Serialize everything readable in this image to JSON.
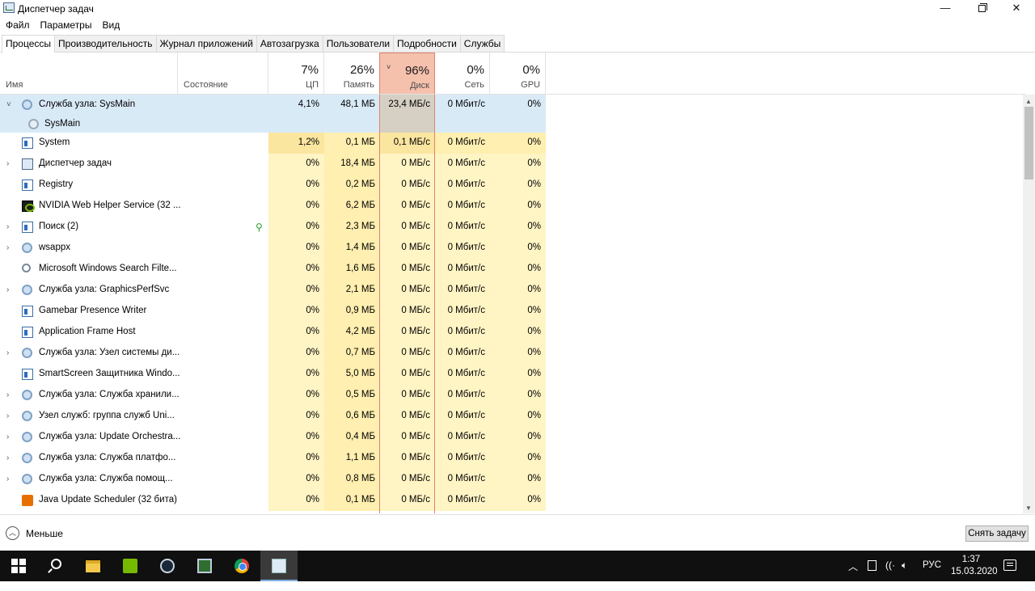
{
  "window": {
    "title": "Диспетчер задач",
    "minimize_glyph": "—",
    "close_glyph": "✕"
  },
  "menu": [
    "Файл",
    "Параметры",
    "Вид"
  ],
  "tabs": [
    "Процессы",
    "Производительность",
    "Журнал приложений",
    "Автозагрузка",
    "Пользователи",
    "Подробности",
    "Службы"
  ],
  "active_tab": "Процессы",
  "columns": {
    "name": "Имя",
    "state": "Состояние",
    "cpu": {
      "percent": "7%",
      "label": "ЦП"
    },
    "memory": {
      "percent": "26%",
      "label": "Память"
    },
    "disk": {
      "percent": "96%",
      "label": "Диск",
      "sort_glyph": "˅"
    },
    "network": {
      "percent": "0%",
      "label": "Сеть"
    },
    "gpu": {
      "percent": "0%",
      "label": "GPU"
    }
  },
  "processes": [
    {
      "name": "Служба узла: SysMain",
      "icon": "gear-icon",
      "expander": "expanded",
      "selected": true,
      "cpu": "4,1%",
      "memory": "48,1 МБ",
      "disk": "23,4 МБ/с",
      "network": "0 Мбит/с",
      "gpu": "0%"
    },
    {
      "name": "SysMain",
      "icon": "service-gear-icon",
      "child": true,
      "selected": true
    },
    {
      "name": "System",
      "icon": "window-icon",
      "cpu": "1,2%",
      "memory": "0,1 МБ",
      "disk": "0,1 МБ/с",
      "network": "0 Мбит/с",
      "gpu": "0%"
    },
    {
      "name": "Диспетчер задач",
      "icon": "task-manager-icon",
      "expander": "collapsed",
      "cpu": "0%",
      "memory": "18,4 МБ",
      "disk": "0 МБ/с",
      "network": "0 Мбит/с",
      "gpu": "0%"
    },
    {
      "name": "Registry",
      "icon": "window-icon",
      "cpu": "0%",
      "memory": "0,2 МБ",
      "disk": "0 МБ/с",
      "network": "0 Мбит/с",
      "gpu": "0%"
    },
    {
      "name": "NVIDIA Web Helper Service (32 ...",
      "icon": "nvidia-icon",
      "cpu": "0%",
      "memory": "6,2 МБ",
      "disk": "0 МБ/с",
      "network": "0 Мбит/с",
      "gpu": "0%"
    },
    {
      "name": "Поиск (2)",
      "icon": "window-icon",
      "expander": "collapsed",
      "suspended": true,
      "cpu": "0%",
      "memory": "2,3 МБ",
      "disk": "0 МБ/с",
      "network": "0 Мбит/с",
      "gpu": "0%"
    },
    {
      "name": "wsappx",
      "icon": "gear-icon",
      "expander": "collapsed",
      "cpu": "0%",
      "memory": "1,4 МБ",
      "disk": "0 МБ/с",
      "network": "0 Мбит/с",
      "gpu": "0%"
    },
    {
      "name": "Microsoft Windows Search Filte...",
      "icon": "search-filter-icon",
      "cpu": "0%",
      "memory": "1,6 МБ",
      "disk": "0 МБ/с",
      "network": "0 Мбит/с",
      "gpu": "0%"
    },
    {
      "name": "Служба узла: GraphicsPerfSvc",
      "icon": "gear-icon",
      "expander": "collapsed",
      "cpu": "0%",
      "memory": "2,1 МБ",
      "disk": "0 МБ/с",
      "network": "0 Мбит/с",
      "gpu": "0%"
    },
    {
      "name": "Gamebar Presence Writer",
      "icon": "window-icon",
      "cpu": "0%",
      "memory": "0,9 МБ",
      "disk": "0 МБ/с",
      "network": "0 Мбит/с",
      "gpu": "0%"
    },
    {
      "name": "Application Frame Host",
      "icon": "window-icon",
      "cpu": "0%",
      "memory": "4,2 МБ",
      "disk": "0 МБ/с",
      "network": "0 Мбит/с",
      "gpu": "0%"
    },
    {
      "name": "Служба узла: Узел системы ди...",
      "icon": "gear-icon",
      "expander": "collapsed",
      "cpu": "0%",
      "memory": "0,7 МБ",
      "disk": "0 МБ/с",
      "network": "0 Мбит/с",
      "gpu": "0%"
    },
    {
      "name": "SmartScreen Защитника Windo...",
      "icon": "window-icon",
      "cpu": "0%",
      "memory": "5,0 МБ",
      "disk": "0 МБ/с",
      "network": "0 Мбит/с",
      "gpu": "0%"
    },
    {
      "name": "Служба узла: Служба хранили...",
      "icon": "gear-icon",
      "expander": "collapsed",
      "cpu": "0%",
      "memory": "0,5 МБ",
      "disk": "0 МБ/с",
      "network": "0 Мбит/с",
      "gpu": "0%"
    },
    {
      "name": "Узел служб: группа служб Uni...",
      "icon": "gear-icon",
      "expander": "collapsed",
      "cpu": "0%",
      "memory": "0,6 МБ",
      "disk": "0 МБ/с",
      "network": "0 Мбит/с",
      "gpu": "0%"
    },
    {
      "name": "Служба узла: Update Orchestra...",
      "icon": "gear-icon",
      "expander": "collapsed",
      "cpu": "0%",
      "memory": "0,4 МБ",
      "disk": "0 МБ/с",
      "network": "0 Мбит/с",
      "gpu": "0%"
    },
    {
      "name": "Служба узла: Служба платфо...",
      "icon": "gear-icon",
      "expander": "collapsed",
      "cpu": "0%",
      "memory": "1,1 МБ",
      "disk": "0 МБ/с",
      "network": "0 Мбит/с",
      "gpu": "0%"
    },
    {
      "name": "Служба узла: Служба помощ...",
      "icon": "gear-icon",
      "expander": "collapsed",
      "cpu": "0%",
      "memory": "0,8 МБ",
      "disk": "0 МБ/с",
      "network": "0 Мбит/с",
      "gpu": "0%"
    },
    {
      "name": "Java Update Scheduler (32 бита)",
      "icon": "java-icon",
      "cpu": "0%",
      "memory": "0,1 МБ",
      "disk": "0 МБ/с",
      "network": "0 Мбит/с",
      "gpu": "0%"
    }
  ],
  "footer": {
    "less_label": "Меньше",
    "end_task_label": "Снять задачу"
  },
  "taskbar": {
    "apps": [
      "start-icon",
      "search-icon",
      "file-explorer-icon",
      "nvidia-icon",
      "steam-icon",
      "app-icon",
      "chrome-icon",
      "task-manager-icon"
    ],
    "active_app": "task-manager-icon",
    "language": "РУС",
    "time": "1:37",
    "date": "15.03.2020"
  }
}
